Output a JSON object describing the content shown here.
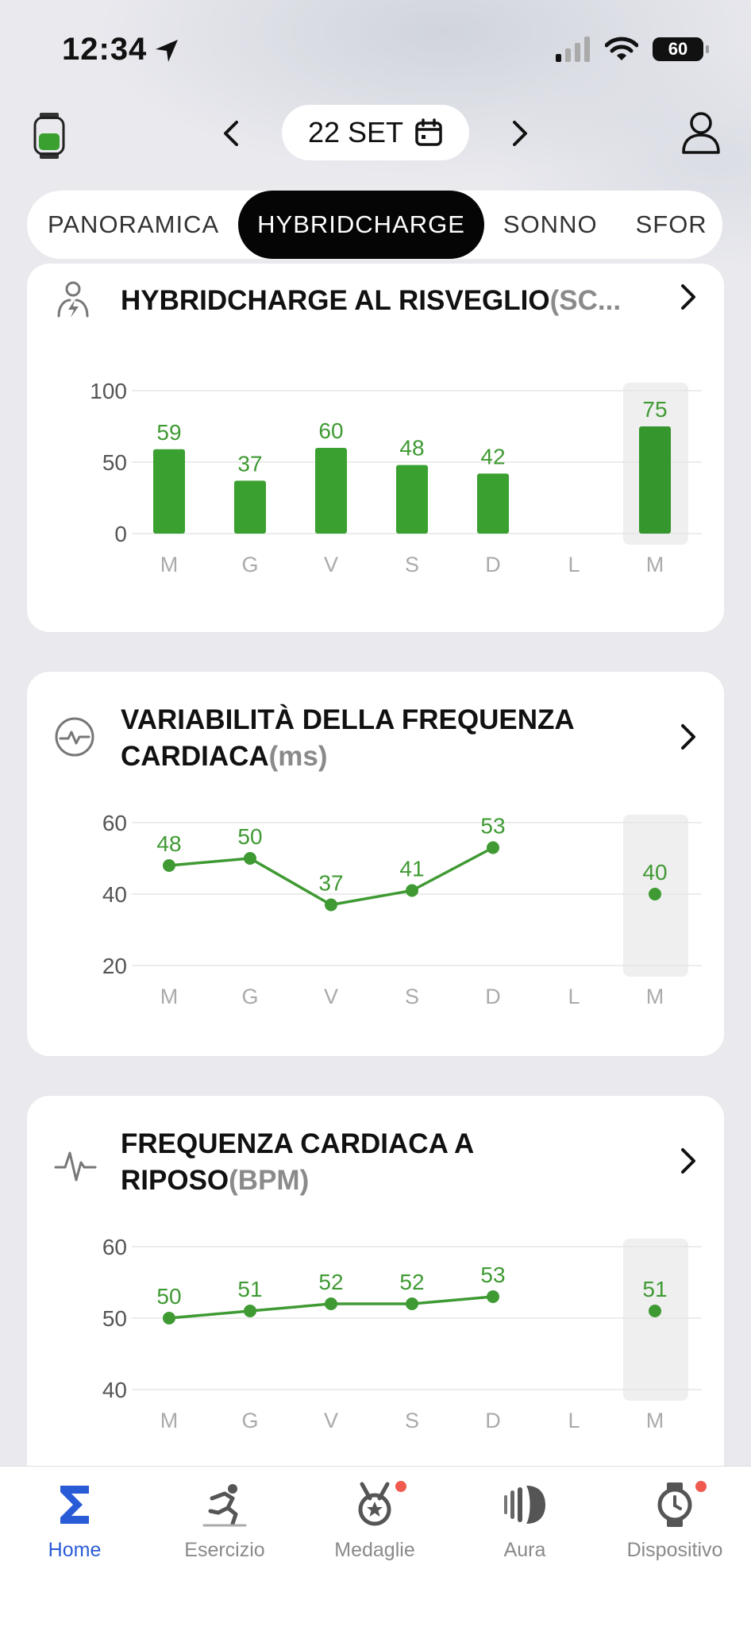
{
  "status_bar": {
    "time": "12:34",
    "battery": "60"
  },
  "header": {
    "date": "22 SET"
  },
  "tabs": [
    {
      "label": "PANORAMICA",
      "active": false
    },
    {
      "label": "HYBRIDCHARGE",
      "active": true
    },
    {
      "label": "SONNO",
      "active": false
    },
    {
      "label": "SFOR",
      "active": false
    }
  ],
  "colors": {
    "bar": "#3aa030",
    "line": "#3f9a33",
    "accent": "#2a5bd7",
    "badge": "#f05a4f"
  },
  "cards": [
    {
      "title": "HYBRIDCHARGE AL RISVEGLIO",
      "unit": "(SC...",
      "icon": "hybridcharge-person-icon",
      "chart_data": {
        "type": "bar",
        "categories": [
          "M",
          "G",
          "V",
          "S",
          "D",
          "L",
          "M"
        ],
        "values": [
          59,
          37,
          60,
          48,
          42,
          null,
          75
        ],
        "ylim": [
          0,
          100
        ],
        "yticks": [
          0,
          50,
          100
        ],
        "highlight_index": 6
      }
    },
    {
      "title": "VARIABILITÀ DELLA FREQUENZA CARDIACA",
      "unit": "(ms)",
      "icon": "heart-rate-variability-icon",
      "chart_data": {
        "type": "line",
        "categories": [
          "M",
          "G",
          "V",
          "S",
          "D",
          "L",
          "M"
        ],
        "values": [
          48,
          50,
          37,
          41,
          53,
          null,
          40
        ],
        "ylim": [
          20,
          60
        ],
        "yticks": [
          20,
          40,
          60
        ],
        "highlight_index": 6
      }
    },
    {
      "title": "FREQUENZA CARDIACA A RIPOSO",
      "unit": "(BPM)",
      "icon": "heart-pulse-icon",
      "chart_data": {
        "type": "line",
        "categories": [
          "M",
          "G",
          "V",
          "S",
          "D",
          "L",
          "M"
        ],
        "values": [
          50,
          51,
          52,
          52,
          53,
          null,
          51
        ],
        "ylim": [
          40,
          60
        ],
        "yticks": [
          40,
          50,
          60
        ],
        "highlight_index": 6
      }
    }
  ],
  "bottom_nav": [
    {
      "label": "Home",
      "icon": "sigma-home-icon",
      "active": true,
      "badge": false
    },
    {
      "label": "Esercizio",
      "icon": "runner-icon",
      "active": false,
      "badge": false
    },
    {
      "label": "Medaglie",
      "icon": "medal-icon",
      "active": false,
      "badge": true
    },
    {
      "label": "Aura",
      "icon": "aura-icon",
      "active": false,
      "badge": false
    },
    {
      "label": "Dispositivo",
      "icon": "watch-device-icon",
      "active": false,
      "badge": true
    }
  ]
}
